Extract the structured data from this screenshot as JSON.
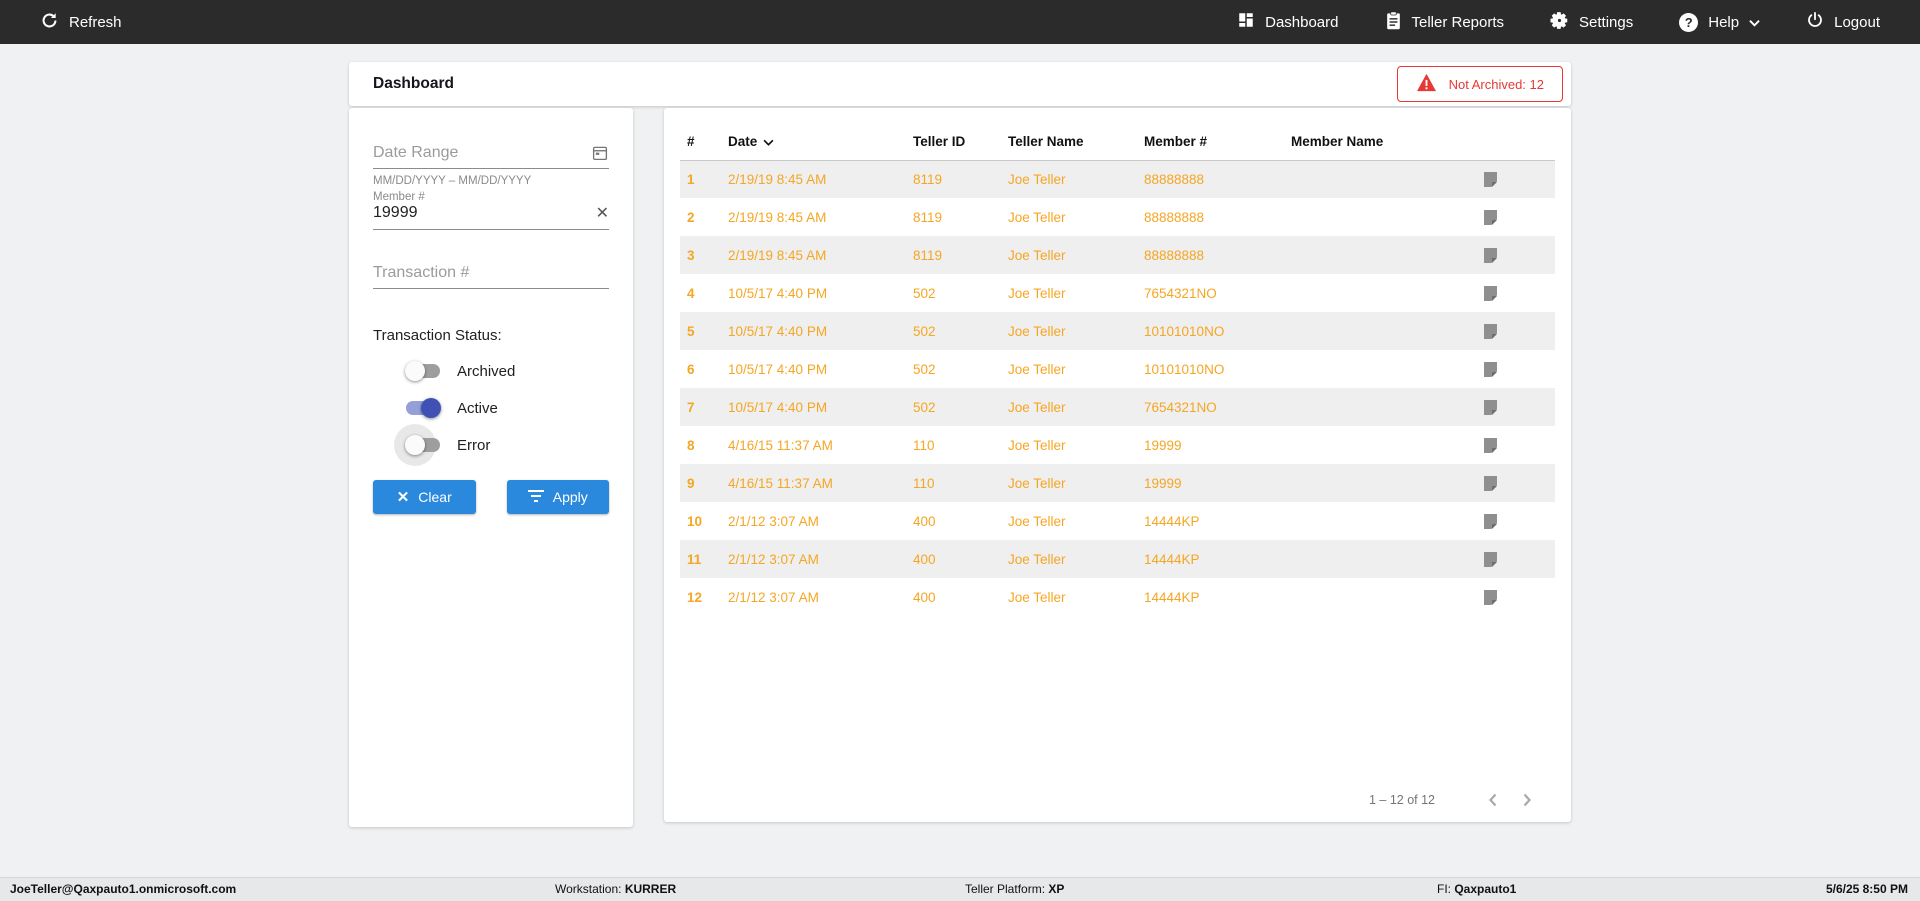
{
  "topbar": {
    "refresh_label": "Refresh",
    "nav": [
      {
        "label": "Dashboard",
        "icon": "dashboard-grid-icon"
      },
      {
        "label": "Teller Reports",
        "icon": "clipboard-icon"
      },
      {
        "label": "Settings",
        "icon": "gear-icon"
      },
      {
        "label": "Help",
        "icon": "help-circle-icon",
        "has_dropdown": true
      },
      {
        "label": "Logout",
        "icon": "power-icon"
      }
    ]
  },
  "header": {
    "title": "Dashboard",
    "not_archived_badge": "Not Archived: 12"
  },
  "filters": {
    "date_range_placeholder": "Date Range",
    "date_range_helper": "MM/DD/YYYY – MM/DD/YYYY",
    "member_label": "Member #",
    "member_value": "19999",
    "transaction_placeholder": "Transaction #",
    "status": {
      "label": "Transaction Status:",
      "toggles": [
        {
          "label": "Archived",
          "on": false,
          "halo": false
        },
        {
          "label": "Active",
          "on": true,
          "halo": false
        },
        {
          "label": "Error",
          "on": false,
          "halo": true
        }
      ]
    },
    "clear_label": "Clear",
    "apply_label": "Apply"
  },
  "table": {
    "columns": [
      "#",
      "Date",
      "Teller ID",
      "Teller Name",
      "Member #",
      "Member Name"
    ],
    "sorted_column": "Date",
    "sort_direction": "desc",
    "rows": [
      {
        "num": "1",
        "date": "2/19/19 8:45 AM",
        "teller_id": "8119",
        "teller_name": "Joe Teller",
        "member_number": "88888888",
        "member_name": ""
      },
      {
        "num": "2",
        "date": "2/19/19 8:45 AM",
        "teller_id": "8119",
        "teller_name": "Joe Teller",
        "member_number": "88888888",
        "member_name": ""
      },
      {
        "num": "3",
        "date": "2/19/19 8:45 AM",
        "teller_id": "8119",
        "teller_name": "Joe Teller",
        "member_number": "88888888",
        "member_name": ""
      },
      {
        "num": "4",
        "date": "10/5/17 4:40 PM",
        "teller_id": "502",
        "teller_name": "Joe Teller",
        "member_number": "7654321NO",
        "member_name": ""
      },
      {
        "num": "5",
        "date": "10/5/17 4:40 PM",
        "teller_id": "502",
        "teller_name": "Joe Teller",
        "member_number": "10101010NO",
        "member_name": ""
      },
      {
        "num": "6",
        "date": "10/5/17 4:40 PM",
        "teller_id": "502",
        "teller_name": "Joe Teller",
        "member_number": "10101010NO",
        "member_name": ""
      },
      {
        "num": "7",
        "date": "10/5/17 4:40 PM",
        "teller_id": "502",
        "teller_name": "Joe Teller",
        "member_number": "7654321NO",
        "member_name": ""
      },
      {
        "num": "8",
        "date": "4/16/15 11:37 AM",
        "teller_id": "110",
        "teller_name": "Joe Teller",
        "member_number": "19999",
        "member_name": ""
      },
      {
        "num": "9",
        "date": "4/16/15 11:37 AM",
        "teller_id": "110",
        "teller_name": "Joe Teller",
        "member_number": "19999",
        "member_name": ""
      },
      {
        "num": "10",
        "date": "2/1/12 3:07 AM",
        "teller_id": "400",
        "teller_name": "Joe Teller",
        "member_number": "14444KP",
        "member_name": ""
      },
      {
        "num": "11",
        "date": "2/1/12 3:07 AM",
        "teller_id": "400",
        "teller_name": "Joe Teller",
        "member_number": "14444KP",
        "member_name": ""
      },
      {
        "num": "12",
        "date": "2/1/12 3:07 AM",
        "teller_id": "400",
        "teller_name": "Joe Teller",
        "member_number": "14444KP",
        "member_name": ""
      }
    ],
    "pagination": {
      "range_label": "1 – 12 of 12"
    }
  },
  "footer": {
    "user": "JoeTeller@Qaxpauto1.onmicrosoft.com",
    "workstation_label": "Workstation:",
    "workstation_value": "KURRER",
    "platform_label": "Teller Platform:",
    "platform_value": "XP",
    "fi_label": "FI:",
    "fi_value": "Qaxpauto1",
    "datetime": "5/6/25 8:50 PM"
  },
  "colors": {
    "topbar_bg": "#2b2b2b",
    "accent_blue": "#2a88dd",
    "alert_red": "#e53935",
    "row_orange": "#f5a623",
    "toggle_indigo": "#3f51b5"
  }
}
